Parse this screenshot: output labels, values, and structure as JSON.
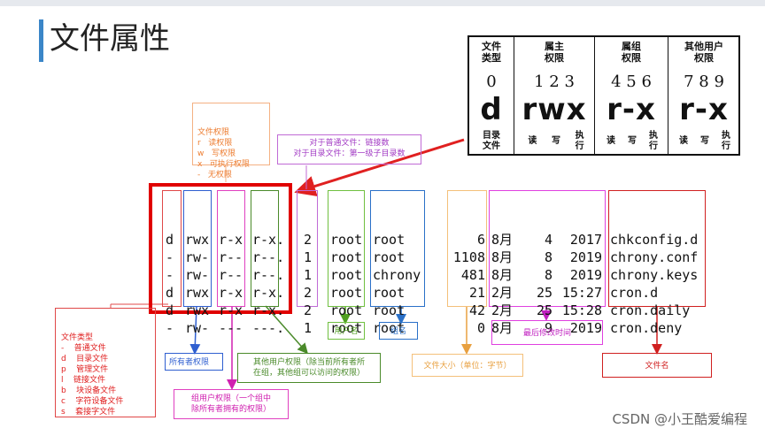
{
  "title": "文件属性",
  "perm_table": {
    "headers": [
      {
        "l1": "文件",
        "l2": "类型"
      },
      {
        "l1": "属主",
        "l2": "权限"
      },
      {
        "l1": "属组",
        "l2": "权限"
      },
      {
        "l1": "其他用户",
        "l2": "权限"
      }
    ],
    "numbers": [
      "0",
      "1 2 3",
      "4 5 6",
      "7 8 9"
    ],
    "symbols": [
      "d",
      "rwx",
      "r-x",
      "r-x"
    ],
    "sub_type": {
      "l1": "目录",
      "l2": "文件"
    },
    "sub_rwx": [
      {
        "r": "读",
        "w": "写",
        "x1": "执",
        "x2": "行"
      },
      {
        "r": "读",
        "w": "写",
        "x1": "执",
        "x2": "行"
      },
      {
        "r": "读",
        "w": "写",
        "x1": "执",
        "x2": "行"
      }
    ]
  },
  "perm_legend": [
    "文件权限",
    "r   读权限",
    "w   写权限",
    "x   可执行权限",
    "-   无权限"
  ],
  "link_note": [
    "对于普通文件：链接数",
    "对于目录文件：第一级子目录数"
  ],
  "filetype_legend": [
    "文件类型",
    "-    普通文件",
    "d    目录文件",
    "p    管理文件",
    "l    链接文件",
    "b    块设备文件",
    "c    字符设备文件",
    "s    套接字文件"
  ],
  "owner_label": "所有者权限",
  "group_label": [
    "组用户权限（一个组中",
    "除所有者拥有的权限）"
  ],
  "other_label": [
    "其他用户权限（除当前所有者所",
    "在组，其他组可以访问的权限）"
  ],
  "user_label": "用户名",
  "groupname_label": "组名",
  "size_label": "文件大小（单位：字节）",
  "mtime_label": "最后修改时间",
  "filename_label": "文件名",
  "listing": {
    "type": [
      "d",
      "-",
      "-",
      "d",
      "d",
      "-"
    ],
    "owner": [
      "rwx",
      "rw-",
      "rw-",
      "rwx",
      "rwx",
      "rw-"
    ],
    "group": [
      "r-x",
      "r--",
      "r--",
      "r-x",
      "r-x",
      "---"
    ],
    "other": [
      "r-x.",
      "r--.",
      "r--.",
      "r-x.",
      "r-x.",
      "---."
    ],
    "links": [
      "2",
      "1",
      "1",
      "2",
      "2",
      "1"
    ],
    "user": [
      "root",
      "root",
      "root",
      "root",
      "root",
      "root"
    ],
    "grp": [
      "root",
      "root",
      "chrony",
      "root",
      "root",
      "root"
    ],
    "size": [
      "6",
      "1108",
      "481",
      "21",
      "42",
      "0"
    ],
    "month": [
      "8月",
      "8月",
      "8月",
      "2月",
      "2月",
      "8月"
    ],
    "day": [
      "4",
      "8",
      "8",
      "25",
      "25",
      "9"
    ],
    "time": [
      "2017",
      "2019",
      "2019",
      "15:27",
      "15:28",
      "2019"
    ],
    "name": [
      "chkconfig.d",
      "chrony.conf",
      "chrony.keys",
      "cron.d",
      "cron.daily",
      "cron.deny"
    ]
  },
  "watermark": "CSDN @小王酷爱编程"
}
